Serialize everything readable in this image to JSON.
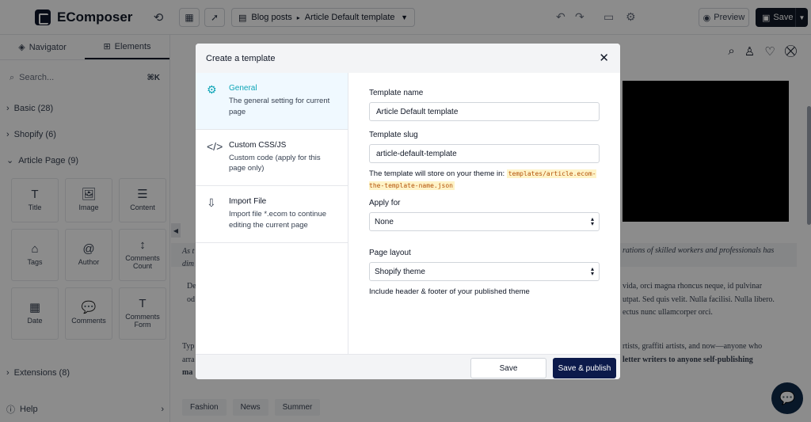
{
  "app": {
    "logo_text": "EComposer",
    "breadcrumb": {
      "section": "Blog posts",
      "page": "Article Default template"
    },
    "preview_label": "Preview",
    "save_label": "Save"
  },
  "sidebar": {
    "tabs": [
      {
        "label": "Navigator"
      },
      {
        "label": "Elements"
      }
    ],
    "search_placeholder": "Search...",
    "search_shortcut": "⌘K",
    "sections": [
      {
        "label": "Basic (28)"
      },
      {
        "label": "Shopify (6)"
      },
      {
        "label": "Article Page (9)"
      }
    ],
    "elements": [
      {
        "label": "Title",
        "icon": "T"
      },
      {
        "label": "Image",
        "icon": "🖼"
      },
      {
        "label": "Content",
        "icon": "☰"
      },
      {
        "label": "Tags",
        "icon": "⌂"
      },
      {
        "label": "Author",
        "icon": "@"
      },
      {
        "label": "Comments Count",
        "icon": "↕"
      },
      {
        "label": "Date",
        "icon": "▦"
      },
      {
        "label": "Comments",
        "icon": "💬"
      },
      {
        "label": "Comments Form",
        "icon": "T"
      }
    ],
    "extensions_label": "Extensions (8)",
    "help_label": "Help"
  },
  "canvas": {
    "quote_text": "rations of skilled workers and professionals has",
    "quote_left_a": "As t",
    "quote_left_b": "dim",
    "para1_right": "vida, orci magna rhoncus neque, id pulvinar",
    "para2_right": "utpat. Sed quis velit. Nulla facilisi. Nulla libero.",
    "para3_right": "ectus nunc ullamcorper orci.",
    "para1_left": "De",
    "para2_left": "od",
    "para4_left": "Typ",
    "para4_right": "rtists, graffiti artists, and now—anyone who",
    "para5_left": "arra",
    "para5_right": "letter writers to anyone self-publishing",
    "para6_left": "ma",
    "tags": [
      "Fashion",
      "News",
      "Summer"
    ]
  },
  "modal": {
    "title": "Create a template",
    "nav": [
      {
        "title": "General",
        "desc": "The general setting for current page"
      },
      {
        "title": "Custom CSS/JS",
        "desc": "Custom code (apply for this page only)"
      },
      {
        "title": "Import File",
        "desc": "Import file *.ecom to continue editing the current page"
      }
    ],
    "template_name_label": "Template name",
    "template_name_value": "Article Default template",
    "template_slug_label": "Template slug",
    "template_slug_value": "article-default-template",
    "store_hint": "The template will store on your theme in:",
    "store_path": "templates/article.ecom-the-template-name.json",
    "apply_for_label": "Apply for",
    "apply_for_value": "None",
    "page_layout_label": "Page layout",
    "page_layout_value": "Shopify theme",
    "page_layout_hint": "Include header & footer of your published theme",
    "save_button": "Save",
    "publish_button": "Save & publish"
  }
}
